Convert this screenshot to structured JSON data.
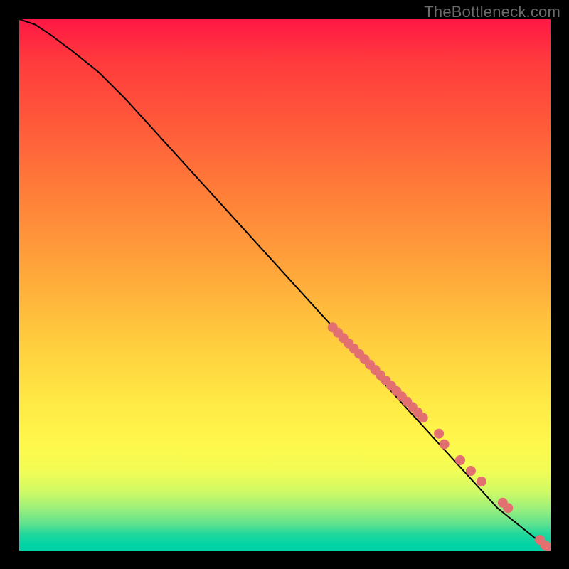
{
  "watermark": "TheBottleneck.com",
  "chart_data": {
    "type": "line",
    "title": "",
    "xlabel": "",
    "ylabel": "",
    "xlim": [
      0,
      100
    ],
    "ylim": [
      0,
      100
    ],
    "grid": false,
    "series": [
      {
        "name": "curve",
        "x": [
          0,
          3,
          6,
          10,
          15,
          20,
          30,
          40,
          50,
          60,
          70,
          80,
          90,
          100
        ],
        "y": [
          100,
          99,
          97,
          94,
          90,
          85,
          74,
          63,
          52,
          41,
          30,
          19,
          8,
          0
        ]
      }
    ],
    "points": {
      "name": "markers",
      "x": [
        59,
        60,
        61,
        62,
        63,
        64,
        65,
        66,
        67,
        68,
        69,
        70,
        71,
        72,
        73,
        74,
        75,
        76,
        79,
        80,
        83,
        85,
        87,
        91,
        92,
        98,
        99,
        100
      ],
      "y": [
        42,
        41,
        40,
        39,
        38,
        37,
        36,
        35,
        34,
        33,
        32,
        31,
        30,
        29,
        28,
        27,
        26,
        25,
        22,
        20,
        17,
        15,
        13,
        9,
        8,
        2,
        1,
        0
      ]
    },
    "colors": {
      "curve": "#000000",
      "markers": "#e27070"
    }
  }
}
